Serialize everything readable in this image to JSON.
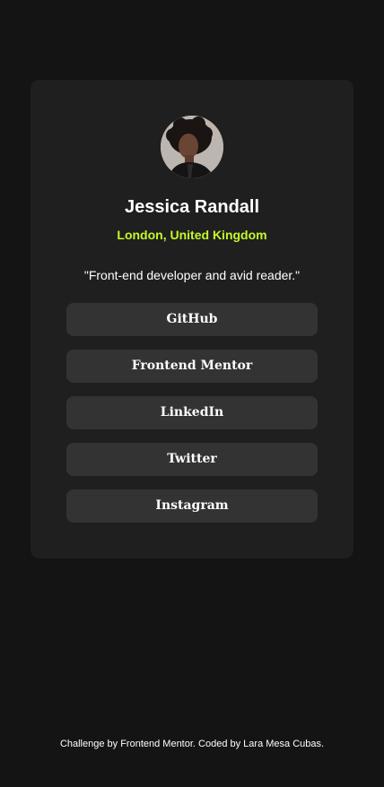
{
  "profile": {
    "name": "Jessica Randall",
    "location": "London, United Kingdom",
    "bio": "\"Front-end developer and avid reader.\""
  },
  "links": [
    {
      "label": "GitHub"
    },
    {
      "label": "Frontend Mentor"
    },
    {
      "label": "LinkedIn"
    },
    {
      "label": "Twitter"
    },
    {
      "label": "Instagram"
    }
  ],
  "footer": {
    "text": "Challenge by Frontend Mentor. Coded by Lara Mesa Cubas."
  },
  "colors": {
    "page_background": "#141414",
    "card_background": "#1f1f1f",
    "button_background": "#333333",
    "accent": "#c4f82a",
    "text": "#ffffff"
  }
}
